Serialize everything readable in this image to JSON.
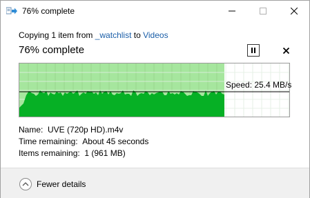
{
  "window": {
    "title": "76% complete"
  },
  "copy": {
    "prefix": "Copying 1 item from ",
    "source": "_watchlist",
    "middle": " to ",
    "destination": "Videos"
  },
  "progress": {
    "headline": "76% complete",
    "percent": 76,
    "speed_label": "Speed: 25.4 MB/s"
  },
  "details": {
    "name_label": "Name:",
    "name_value": "UVE (720p HD).m4v",
    "time_label": "Time remaining:",
    "time_value": "About 45 seconds",
    "items_label": "Items remaining:",
    "items_value": "1 (961 MB)"
  },
  "footer": {
    "fewer_details": "Fewer details"
  },
  "colors": {
    "graph_fill": "#06b025",
    "graph_progress_bg": "#a6e69e",
    "link": "#1a5ea8"
  }
}
